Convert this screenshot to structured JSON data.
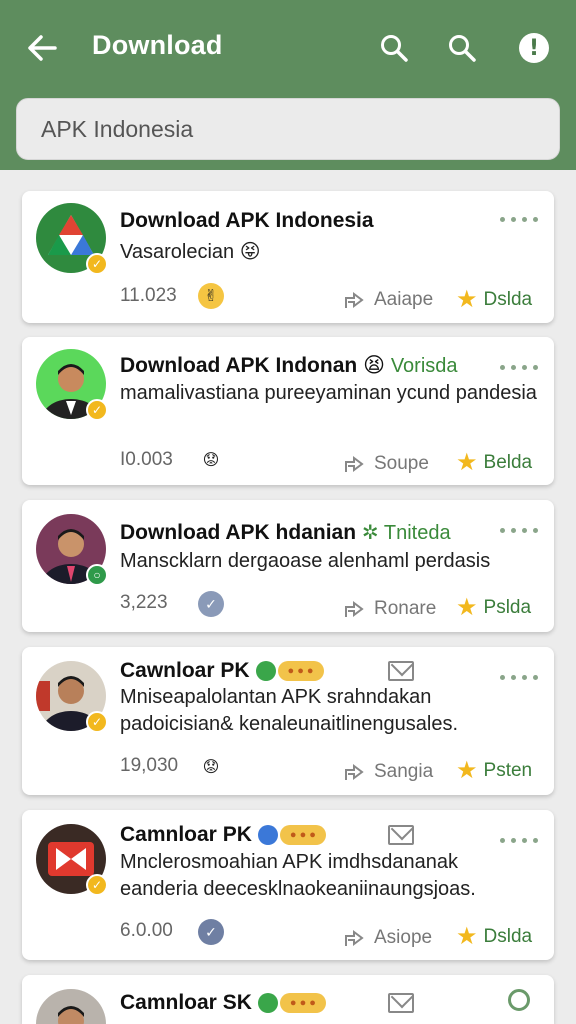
{
  "appbar": {
    "title": "Download",
    "colors": {
      "bar": "#5e8d5e",
      "accent": "#3b7d3b",
      "star": "#f2b81e"
    },
    "icons": [
      "back-arrow-icon",
      "search-icon",
      "search-icon",
      "info-icon"
    ],
    "info_glyph": "!"
  },
  "search": {
    "placeholder": "APK Indonesia"
  },
  "cards": [
    {
      "title": "Download APK Indonesia",
      "extra": "",
      "desc": "Vasarolecian",
      "count": "11.023",
      "share_label": "Aaiape",
      "rating_label": "Dslda"
    },
    {
      "title": "Download APK Indonan",
      "extra": "Vorisda",
      "desc": "mamalivastiana pureeyaminan ycund pandesia",
      "count": "I0.003",
      "share_label": "Soupe",
      "rating_label": "Belda"
    },
    {
      "title": "Download APK hdanian",
      "extra": "Tniteda",
      "desc": "Manscklarn dergaoase alenhaml perdasis",
      "count": "3,223",
      "share_label": "Ronare",
      "rating_label": "Pslda"
    },
    {
      "title": "Cawnloar PK",
      "extra": "",
      "desc": "Mniseapalolantan APK srahndakan padoicisian& kenaleunaitlinengusales.",
      "count": "19,030",
      "share_label": "Sangia",
      "rating_label": "Psten"
    },
    {
      "title": "Camnloar PK",
      "extra": "",
      "desc": "Mnclerosmoahian APK imdhsdananak eanderia deecesklnaokeaniinaungsjoas.",
      "count": "6.0.00",
      "share_label": "Asiope",
      "rating_label": "Dslda"
    },
    {
      "title": "Camnloar SK",
      "extra": "",
      "desc": "",
      "count": "",
      "share_label": "",
      "rating_label": ""
    }
  ]
}
